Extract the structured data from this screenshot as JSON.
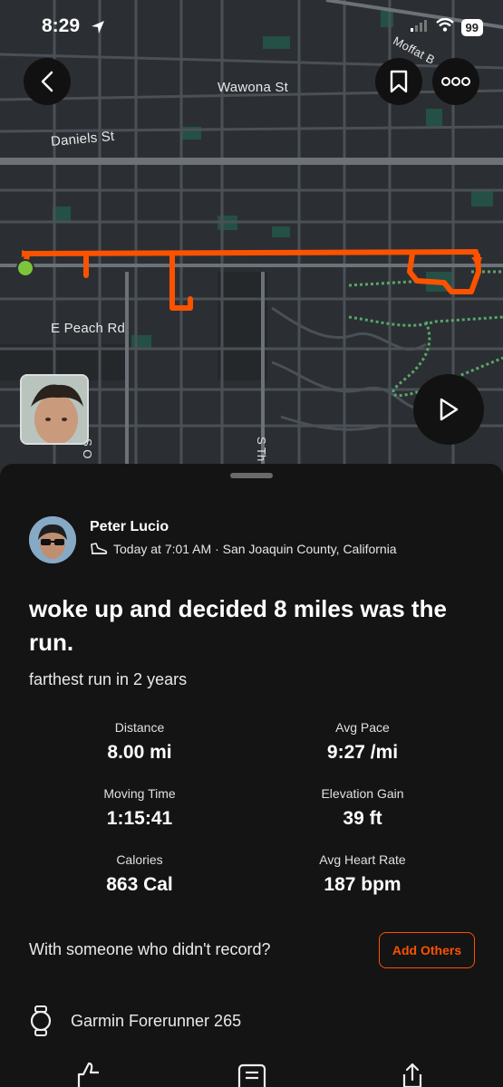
{
  "status_bar": {
    "time": "8:29",
    "battery": "99"
  },
  "map": {
    "labels": {
      "street_1": "Wawona St",
      "street_2": "Daniels St",
      "street_3": "E Peach Rd",
      "street_4": "Moffat B",
      "street_5": "S O",
      "street_6": "S Th"
    },
    "route_color": "#fc5200",
    "start_color": "#7cc53a"
  },
  "icons": {
    "back": "chevron-left-icon",
    "bookmark": "bookmark-icon",
    "more": "more-icon",
    "play": "play-icon",
    "shoe": "shoe-icon",
    "watch": "watch-icon"
  },
  "activity": {
    "athlete": "Peter Lucio",
    "meta": "Today at 7:01 AM · San Joaquin County, California",
    "title": "woke up and decided 8 miles was the run.",
    "description": "farthest run in 2 years",
    "stats": [
      {
        "label": "Distance",
        "value": "8.00 mi"
      },
      {
        "label": "Avg Pace",
        "value": "9:27 /mi"
      },
      {
        "label": "Moving Time",
        "value": "1:15:41"
      },
      {
        "label": "Elevation Gain",
        "value": "39 ft"
      },
      {
        "label": "Calories",
        "value": "863 Cal"
      },
      {
        "label": "Avg Heart Rate",
        "value": "187 bpm"
      }
    ],
    "with_prompt": "With someone who didn't record?",
    "add_others": "Add Others",
    "device": "Garmin Forerunner 265"
  },
  "colors": {
    "accent": "#fc5200",
    "sheet_bg": "#141414",
    "map_bg": "#2b2f33"
  }
}
